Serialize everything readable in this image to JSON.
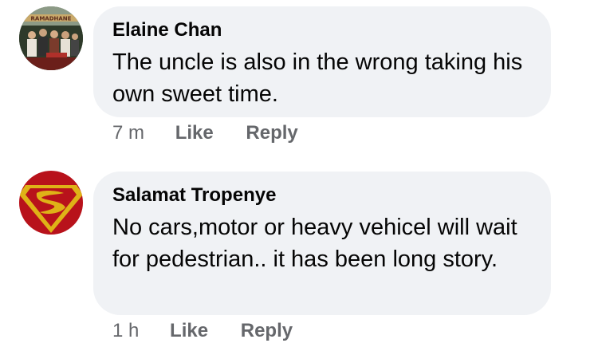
{
  "comments": [
    {
      "author": "Elaine Chan",
      "text": "The uncle is also in the wrong taking his own sweet time.",
      "time": "7 m",
      "like_label": "Like",
      "reply_label": "Reply",
      "avatar_sign_text": "RAMADHANE"
    },
    {
      "author": "Salamat Tropenye",
      "text": "No cars,motor or heavy vehicel will wait for pedestrian.. it has been long story.",
      "time": "1 h",
      "like_label": "Like",
      "reply_label": "Reply"
    }
  ],
  "colors": {
    "bubble_bg": "#f0f2f5",
    "text": "#050505",
    "secondary_text": "#65676b",
    "superman_red": "#c8141e",
    "superman_yellow": "#f2c21a"
  }
}
